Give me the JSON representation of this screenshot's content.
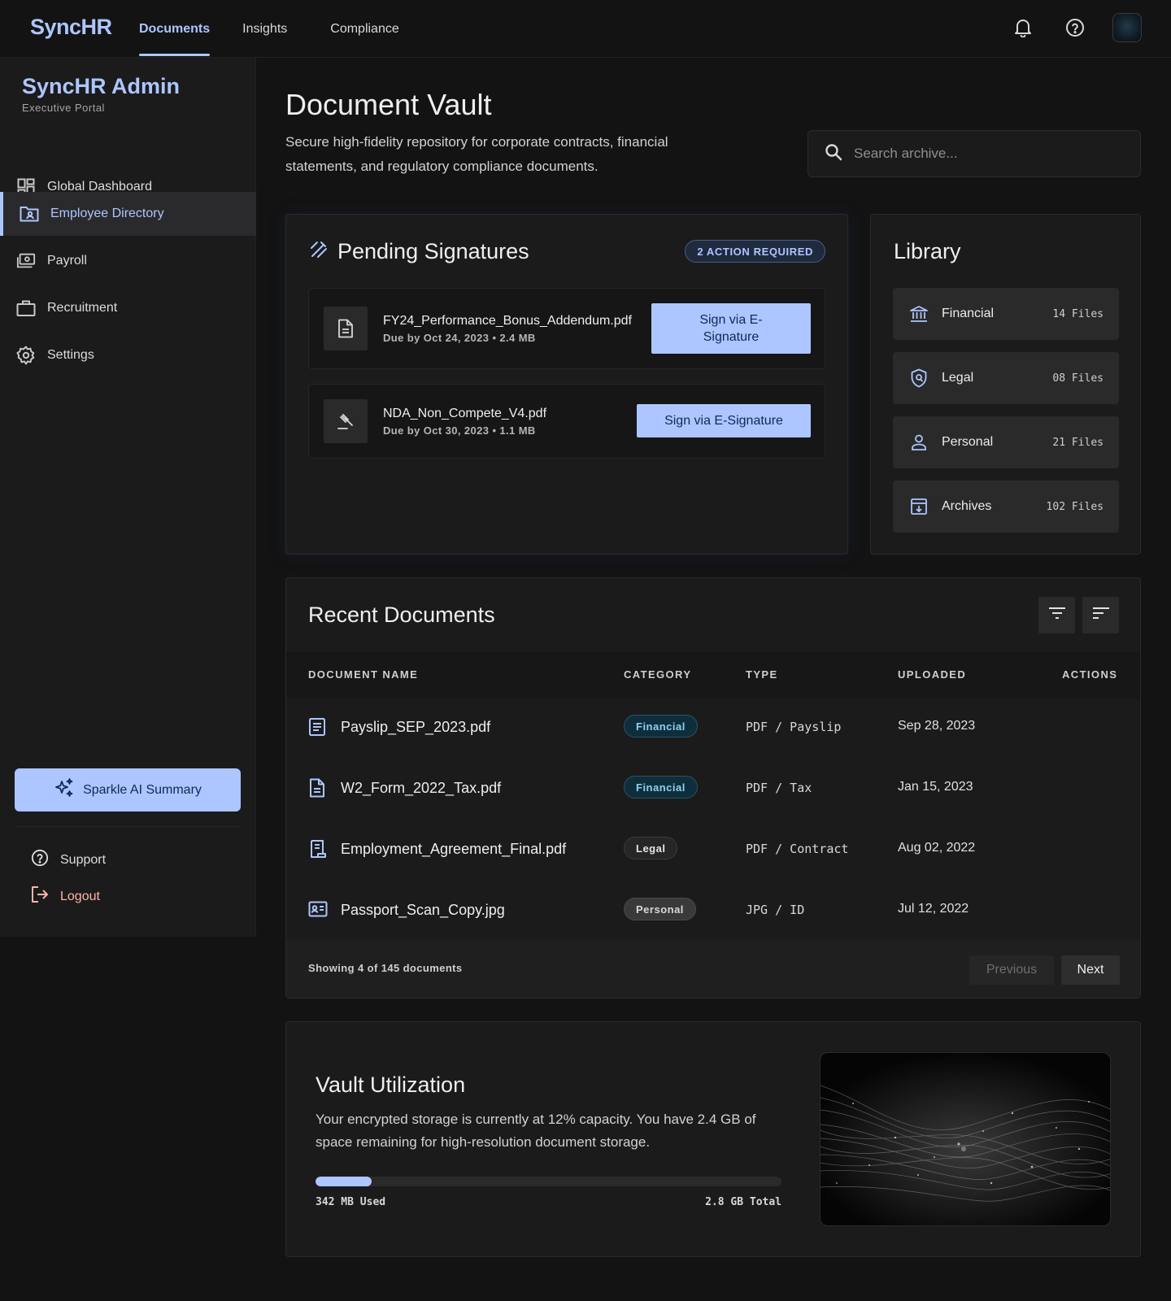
{
  "topbar": {
    "brand": "SyncHR",
    "tabs": [
      {
        "label": "Documents",
        "active": true
      },
      {
        "label": "Insights"
      },
      {
        "label": "Compliance"
      }
    ],
    "icons": [
      "bell-icon",
      "help-icon"
    ]
  },
  "sidebar": {
    "title": "SyncHR Admin",
    "subtitle": "Executive Portal",
    "items": [
      {
        "label": "Global Dashboard",
        "icon": "dashboard-icon"
      },
      {
        "label": "Employee Directory",
        "icon": "folder-user-icon",
        "active": true
      },
      {
        "label": "Payroll",
        "icon": "payments-icon"
      },
      {
        "label": "Recruitment",
        "icon": "briefcase-icon"
      },
      {
        "label": "Settings",
        "icon": "gear-icon"
      }
    ],
    "ai_button": "Sparkle AI Summary",
    "support": "Support",
    "logout": "Logout"
  },
  "main": {
    "title": "Document Vault",
    "description": "Secure high-fidelity repository for corporate contracts, financial statements, and regulatory compliance documents.",
    "search_placeholder": "Search archive..."
  },
  "pending": {
    "title": "Pending Signatures",
    "badge": "2 ACTION REQUIRED",
    "items": [
      {
        "name": "FY24_Performance_Bonus_Addendum.pdf",
        "meta": "Due by Oct 24, 2023 • 2.4 MB",
        "button": "Sign via E-Signature"
      },
      {
        "name": "NDA_Non_Compete_V4.pdf",
        "meta": "Due by Oct 30, 2023 • 1.1 MB",
        "button": "Sign via E-Signature"
      }
    ]
  },
  "library": {
    "title": "Library",
    "items": [
      {
        "label": "Financial",
        "count": "14 Files",
        "icon": "bank-icon"
      },
      {
        "label": "Legal",
        "count": "08 Files",
        "icon": "shield-icon"
      },
      {
        "label": "Personal",
        "count": "21 Files",
        "icon": "person-icon"
      },
      {
        "label": "Archives",
        "count": "102 Files",
        "icon": "archive-icon"
      }
    ]
  },
  "recent": {
    "title": "Recent Documents",
    "columns": [
      "DOCUMENT NAME",
      "CATEGORY",
      "TYPE",
      "UPLOADED",
      "ACTIONS"
    ],
    "rows": [
      {
        "name": "Payslip_SEP_2023.pdf",
        "category": "Financial",
        "type": "PDF / Payslip",
        "uploaded": "Sep 28, 2023",
        "icon": "receipt-icon"
      },
      {
        "name": "W2_Form_2022_Tax.pdf",
        "category": "Financial",
        "type": "PDF / Tax",
        "uploaded": "Jan 15, 2023",
        "icon": "document-icon"
      },
      {
        "name": "Employment_Agreement_Final.pdf",
        "category": "Legal",
        "type": "PDF / Contract",
        "uploaded": "Aug 02, 2022",
        "icon": "contract-icon"
      },
      {
        "name": "Passport_Scan_Copy.jpg",
        "category": "Personal",
        "type": "JPG / ID",
        "uploaded": "Jul 12, 2022",
        "icon": "id-card-icon"
      }
    ],
    "showing": "Showing 4 of 145 documents",
    "prev": "Previous",
    "next": "Next"
  },
  "vault": {
    "title": "Vault Utilization",
    "description": "Your encrypted storage is currently at 12% capacity. You have 2.4 GB of space remaining for high-resolution document storage.",
    "used_fraction": 0.12,
    "used_label": "342 MB Used",
    "total_label": "2.8 GB Total"
  },
  "colors": {
    "accent": "#adc6ff",
    "background": "#131313",
    "surface": "#1b1b1b",
    "logout": "#ffb4a5"
  }
}
